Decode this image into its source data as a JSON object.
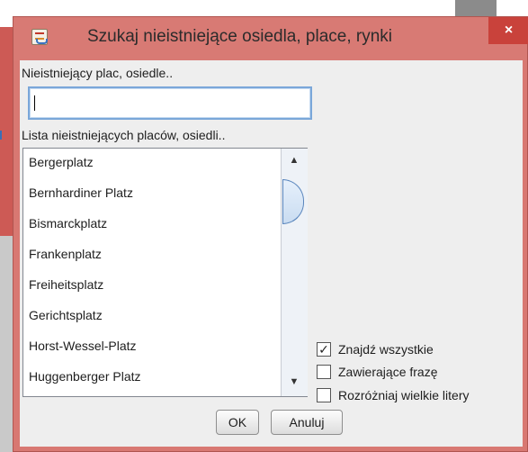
{
  "window": {
    "title": "Szukaj nieistniejące osiedla, place, rynki",
    "close_glyph": "×"
  },
  "search": {
    "label": "Nieistniejący plac, osiedle..",
    "value": ""
  },
  "list": {
    "label": "Lista nieistniejących placów, osiedli..",
    "items": [
      "Bergerplatz",
      "Bernhardiner Platz",
      "Bismarckplatz",
      "Frankenplatz",
      "Freiheitsplatz",
      "Gerichtsplatz",
      "Horst-Wessel-Platz",
      "Huggenberger Platz"
    ]
  },
  "options": {
    "find_all": {
      "label": "Znajdź wszystkie",
      "checked": true,
      "mark": "✓"
    },
    "contains_phrase": {
      "label": "Zawierające frazę",
      "checked": false,
      "mark": ""
    },
    "case_sensitive": {
      "label": "Rozróżniaj wielkie litery",
      "checked": false,
      "mark": ""
    }
  },
  "buttons": {
    "ok": "OK",
    "cancel": "Anuluj"
  },
  "colors": {
    "titlebar": "#d87a74",
    "close_button": "#c9423b",
    "content_bg": "#eeeeee"
  }
}
